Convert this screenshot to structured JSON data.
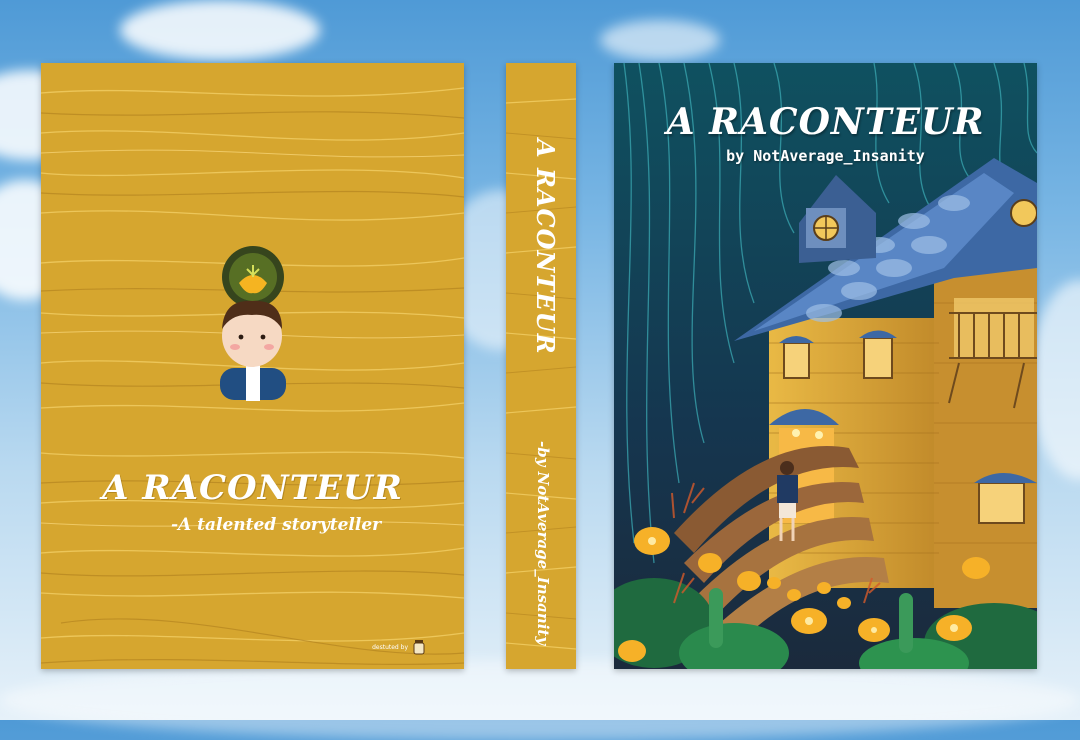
{
  "back_cover": {
    "title": "A RACONTEUR",
    "tagline": "-A talented storyteller",
    "credit": "destuted by"
  },
  "spine": {
    "title": "A RACONTEUR",
    "author": "-by NotAverage_Insanity"
  },
  "front_cover": {
    "title": "A RACONTEUR",
    "author": "by NotAverage_Insanity"
  },
  "colors": {
    "sky": "#79b6e4",
    "cover_yellow": "#d6a62f",
    "forest": "#163f5e",
    "roof_blue": "#4c78b4",
    "house_wood": "#d9a43a"
  }
}
